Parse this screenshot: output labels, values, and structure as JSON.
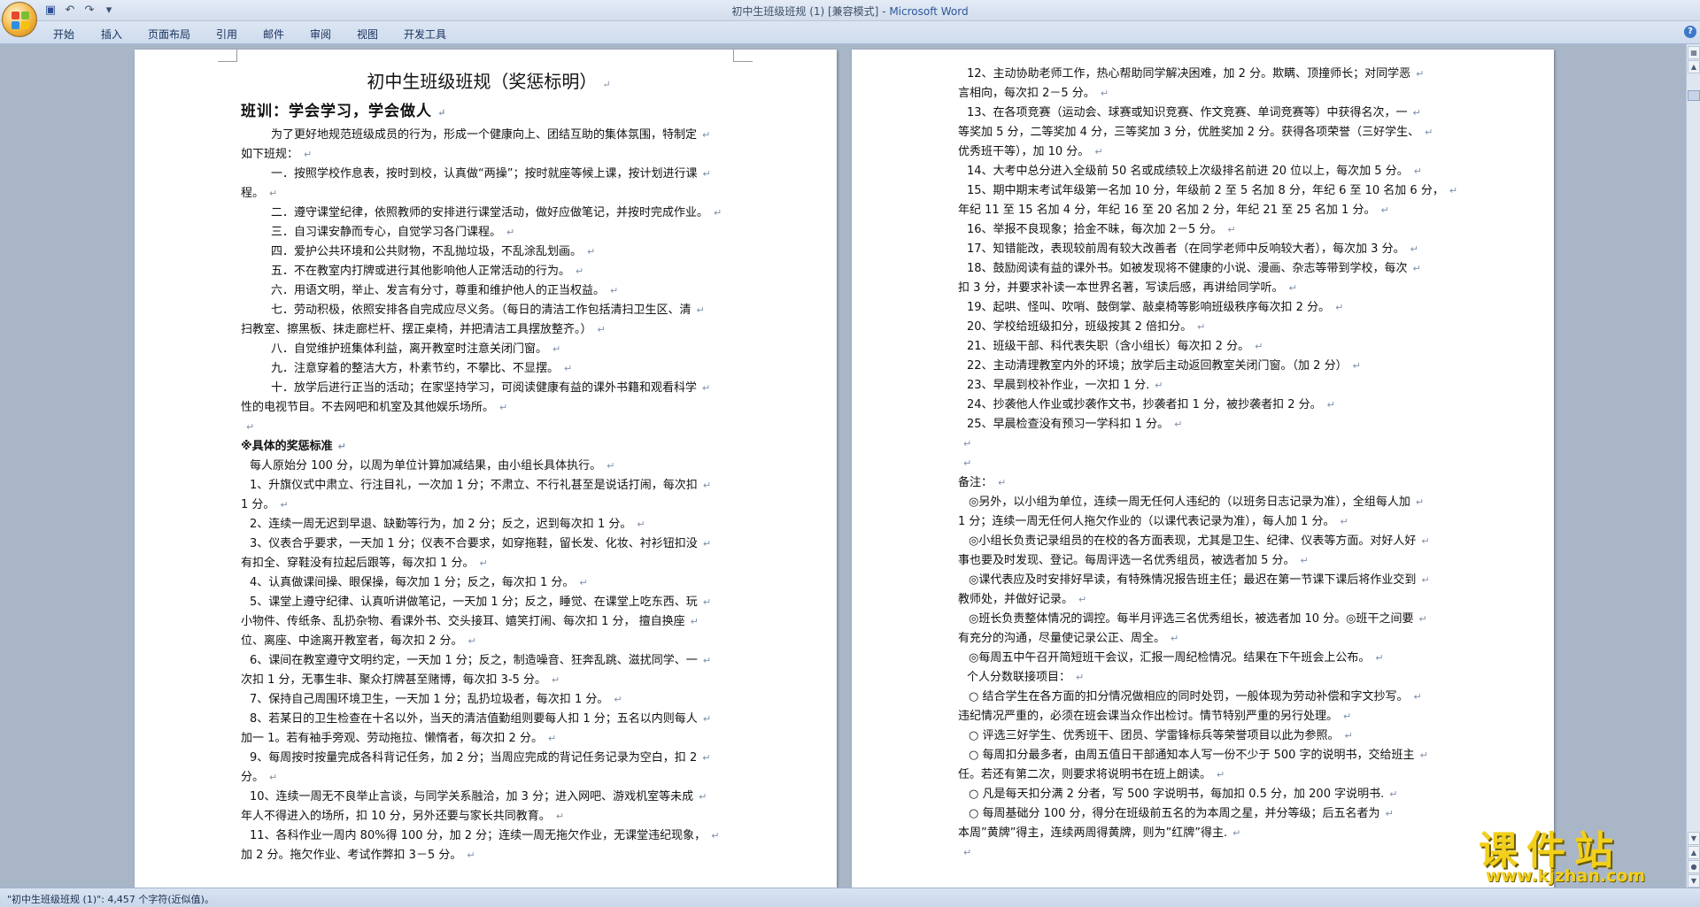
{
  "window": {
    "title_prefix": "初中生班级班规 (1) [兼容模式] - ",
    "title_app": "Microsoft Word"
  },
  "quick_access": {
    "save_icon": "save-icon",
    "undo_icon": "undo-icon",
    "redo_icon": "redo-icon",
    "customize_icon": "dropdown-icon"
  },
  "ribbon": {
    "tabs": [
      "开始",
      "插入",
      "页面布局",
      "引用",
      "邮件",
      "审阅",
      "视图",
      "开发工具"
    ],
    "help": "?"
  },
  "left_page": {
    "title": "初中生班级班规（奖惩标明）",
    "motto": "班训：学会学习，学会做人",
    "lines": [
      "为了更好地规范班级成员的行为，形成一个健康向上、团结互助的集体氛围，特制定",
      "如下班规：",
      "一．按照学校作息表，按时到校，认真做“两操”；按时就座等候上课，按计划进行课",
      "程。",
      "二．遵守课堂纪律，依照教师的安排进行课堂活动，做好应做笔记，并按时完成作业。",
      "三．自习课安静而专心，自觉学习各门课程。",
      "四．爱护公共环境和公共财物，不乱抛垃圾，不乱涂乱划画。",
      "五．不在教室内打牌或进行其他影响他人正常活动的行为。",
      "六．用语文明，举止、发言有分寸，尊重和维护他人的正当权益。",
      "七．劳动积极，依照安排各自完成应尽义务。（每日的清洁工作包括清扫卫生区、清",
      "扫教室、擦黑板、抹走廊栏杆、摆正桌椅，并把清洁工具摆放整齐。）",
      "八．自觉维护班集体利益，离开教室时注意关闭门窗。",
      "九．注意穿着的整洁大方，朴素节约，不攀比、不显摆。",
      "十．放学后进行正当的活动；在家坚持学习，可阅读健康有益的课外书籍和观看科学",
      "性的电视节目。不去网吧和机室及其他娱乐场所。",
      "",
      "※具体的奖惩标准",
      "每人原始分 100 分，以周为单位计算加减结果，由小组长具体执行。",
      "1、升旗仪式中肃立、行注目礼，一次加 1 分；不肃立、不行礼甚至是说话打闹，每次扣",
      "1 分。",
      "2、连续一周无迟到早退、缺勤等行为，加 2 分；反之，迟到每次扣 1 分。",
      "3、仪表合乎要求，一天加 1 分；仪表不合要求，如穿拖鞋，留长发、化妆、衬衫钮扣没",
      "有扣全、穿鞋没有拉起后跟等，每次扣 1 分。",
      "4、认真做课间操、眼保操，每次加 1 分；反之，每次扣 1 分。",
      "5、课堂上遵守纪律、认真听讲做笔记，一天加 1 分；反之，睡觉、在课堂上吃东西、玩",
      "小物件、传纸条、乱扔杂物、看课外书、交头接耳、嬉笑打闹、每次扣 1 分，   擅自换座",
      "位、离座、中途离开教室者，每次扣 2 分。",
      "6、课间在教室遵守文明约定，一天加 1 分；反之，制造噪音、狂奔乱跳、滋扰同学、一",
      "次扣 1 分，无事生非、聚众打牌甚至赌博，每次扣 3-5 分。",
      "7、保持自己周围环境卫生，一天加 1 分；乱扔垃圾者，每次扣 1 分。",
      "8、若某日的卫生检查在十名以外，当天的清洁值勤组则要每人扣 1 分；五名以内则每人",
      "加一 1。若有袖手旁观、劳动拖拉、懒惰者，每次扣 2 分。",
      "9、每周按时按量完成各科背记任务，加 2 分；当周应完成的背记任务记录为空白，扣 2",
      "分。",
      "10、连续一周无不良举止言谈，与同学关系融洽，加 3 分；进入网吧、游戏机室等未成",
      "年人不得进入的场所，扣 10 分，另外还要与家长共同教育。",
      "11、各科作业一周内 80%得 100 分，加 2 分；连续一周无拖欠作业，无课堂违纪现象，",
      "加 2 分。拖欠作业、考试作弊扣 3－5 分。"
    ]
  },
  "right_page": {
    "lines": [
      "12、主动协助老师工作，热心帮助同学解决困难，加 2 分。欺瞒、顶撞师长；对同学恶",
      "言相向，每次扣 2－5 分。",
      "13、在各项竞赛（运动会、球赛或知识竞赛、作文竞赛、单词竞赛等）中获得名次，一",
      "等奖加 5 分，二等奖加 4 分，三等奖加 3 分，优胜奖加 2 分。获得各项荣誉（三好学生、",
      "优秀班干等），加 10 分。",
      "14、大考中总分进入全级前 50 名或成绩较上次级排名前进 20 位以上，每次加 5 分。",
      "15、期中期末考试年级第一名加 10 分，年级前 2 至 5 名加 8 分，年纪 6 至 10 名加 6 分，",
      "年纪 11 至 15 名加 4 分，年纪 16 至 20 名加 2 分，年纪 21 至 25 名加 1 分。",
      "16、举报不良现象；拾金不昧，每次加 2－5 分。",
      "17、知错能改，表现较前周有较大改善者（在同学老师中反响较大者），每次加 3 分。",
      "18、鼓励阅读有益的课外书。如被发现将不健康的小说、漫画、杂志等带到学校，每次",
      "扣 3 分，并要求补读一本世界名著，写读后感，再讲给同学听。",
      "19、起哄、怪叫、吹哨、鼓倒掌、敲桌椅等影响班级秩序每次扣 2 分。",
      "20、学校给班级扣分，班级按其 2 倍扣分。",
      "21、班级干部、科代表失职（含小组长）每次扣 2 分。",
      "22、主动清理教室内外的环境；放学后主动返回教室关闭门窗。（加 2 分）",
      "23、早晨到校补作业，一次扣 1 分.",
      "24、抄袭他人作业或抄袭作文书，抄袭者扣 1 分，被抄袭者扣 2 分。",
      "25、早晨检查没有预习一学科扣 1 分。",
      "",
      "",
      "备注：",
      "◎另外，以小组为单位，连续一周无任何人违纪的（以班务日志记录为准），全组每人加",
      "1 分；连续一周无任何人拖欠作业的（以课代表记录为准），每人加 1 分。",
      "◎小组长负责记录组员的在校的各方面表现，尤其是卫生、纪律、仪表等方面。对好人好",
      "事也要及时发现、登记。每周评选一名优秀组员，被选者加 5 分。",
      "◎课代表应及时安排好早读，有特殊情况报告班主任；最迟在第一节课下课后将作业交到",
      "教师处，并做好记录。",
      "◎班长负责整体情况的调控。每半月评选三名优秀组长，被选者加 10 分。◎班干之间要",
      "有充分的沟通，尽量使记录公正、周全。",
      "◎每周五中午召开简短班干会议，汇报一周纪检情况。结果在下午班会上公布。",
      "个人分数联接项目：",
      "○ 结合学生在各方面的扣分情况做相应的同时处罚，一般体现为劳动补偿和字文抄写。",
      "违纪情况严重的，必须在班会课当众作出检讨。情节特别严重的另行处理。",
      "○ 评选三好学生、优秀班干、团员、学雷锋标兵等荣誉项目以此为参照。",
      "○ 每周扣分最多者，由周五值日干部通知本人写一份不少于 500 字的说明书，交给班主",
      "任。若还有第二次，则要求将说明书在班上朗读。",
      "○ 凡是每天扣分满 2 分者，写 500 字说明书，每加扣 0.5 分，加 200 字说明书.",
      "○ 每周基础分 100 分，得分在班级前五名的为本周之星，并分等级；后五名者为",
      "本周”黄牌”得主，连续两周得黄牌，则为”红牌”得主.",
      ""
    ]
  },
  "status_bar": {
    "text": "\"初中生班级班规 (1)\": 4,457 个字符(近似值)。"
  },
  "watermark": {
    "name": "课件站",
    "url": "www.kjzhan.com"
  }
}
